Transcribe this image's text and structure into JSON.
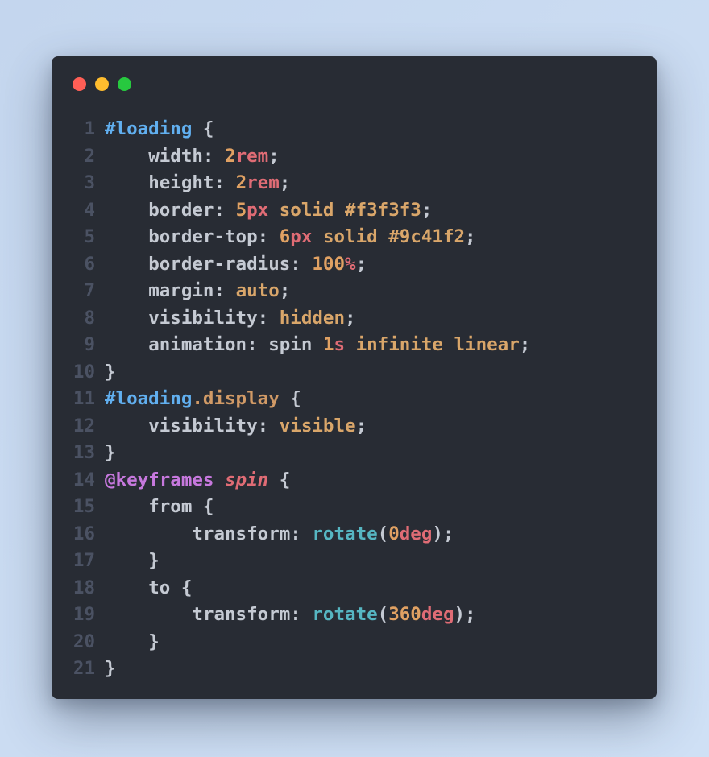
{
  "window": {
    "controls": [
      {
        "name": "close",
        "color": "#ff5f56"
      },
      {
        "name": "minimize",
        "color": "#ffbd2e"
      },
      {
        "name": "maximize",
        "color": "#27c93f"
      }
    ],
    "background_color": "#282c34"
  },
  "code": {
    "language": "css",
    "lines": [
      {
        "n": "1",
        "tokens": [
          [
            "selector",
            "#loading"
          ],
          [
            "punct",
            " {"
          ]
        ]
      },
      {
        "n": "2",
        "tokens": [
          [
            "plain",
            "    "
          ],
          [
            "prop",
            "width"
          ],
          [
            "punct",
            ": "
          ],
          [
            "num",
            "2"
          ],
          [
            "unit",
            "rem"
          ],
          [
            "punct",
            ";"
          ]
        ]
      },
      {
        "n": "3",
        "tokens": [
          [
            "plain",
            "    "
          ],
          [
            "prop",
            "height"
          ],
          [
            "punct",
            ": "
          ],
          [
            "num",
            "2"
          ],
          [
            "unit",
            "rem"
          ],
          [
            "punct",
            ";"
          ]
        ]
      },
      {
        "n": "4",
        "tokens": [
          [
            "plain",
            "    "
          ],
          [
            "prop",
            "border"
          ],
          [
            "punct",
            ": "
          ],
          [
            "num",
            "5"
          ],
          [
            "unit",
            "px"
          ],
          [
            "plain",
            " "
          ],
          [
            "value",
            "solid"
          ],
          [
            "plain",
            " "
          ],
          [
            "value",
            "#f3f3f3"
          ],
          [
            "punct",
            ";"
          ]
        ]
      },
      {
        "n": "5",
        "tokens": [
          [
            "plain",
            "    "
          ],
          [
            "prop",
            "border-top"
          ],
          [
            "punct",
            ": "
          ],
          [
            "num",
            "6"
          ],
          [
            "unit",
            "px"
          ],
          [
            "plain",
            " "
          ],
          [
            "value",
            "solid"
          ],
          [
            "plain",
            " "
          ],
          [
            "value",
            "#9c41f2"
          ],
          [
            "punct",
            ";"
          ]
        ]
      },
      {
        "n": "6",
        "tokens": [
          [
            "plain",
            "    "
          ],
          [
            "prop",
            "border-radius"
          ],
          [
            "punct",
            ": "
          ],
          [
            "num",
            "100"
          ],
          [
            "unit",
            "%"
          ],
          [
            "punct",
            ";"
          ]
        ]
      },
      {
        "n": "7",
        "tokens": [
          [
            "plain",
            "    "
          ],
          [
            "prop",
            "margin"
          ],
          [
            "punct",
            ": "
          ],
          [
            "value",
            "auto"
          ],
          [
            "punct",
            ";"
          ]
        ]
      },
      {
        "n": "8",
        "tokens": [
          [
            "plain",
            "    "
          ],
          [
            "prop",
            "visibility"
          ],
          [
            "punct",
            ": "
          ],
          [
            "value",
            "hidden"
          ],
          [
            "punct",
            ";"
          ]
        ]
      },
      {
        "n": "9",
        "tokens": [
          [
            "plain",
            "    "
          ],
          [
            "prop",
            "animation"
          ],
          [
            "punct",
            ": "
          ],
          [
            "plain",
            "spin "
          ],
          [
            "num",
            "1"
          ],
          [
            "unit",
            "s"
          ],
          [
            "plain",
            " "
          ],
          [
            "value",
            "infinite"
          ],
          [
            "plain",
            " "
          ],
          [
            "value",
            "linear"
          ],
          [
            "punct",
            ";"
          ]
        ]
      },
      {
        "n": "10",
        "tokens": [
          [
            "punct",
            "}"
          ]
        ]
      },
      {
        "n": "11",
        "tokens": [
          [
            "selector",
            "#loading"
          ],
          [
            "class",
            ".display"
          ],
          [
            "punct",
            " {"
          ]
        ]
      },
      {
        "n": "12",
        "tokens": [
          [
            "plain",
            "    "
          ],
          [
            "prop",
            "visibility"
          ],
          [
            "punct",
            ": "
          ],
          [
            "value",
            "visible"
          ],
          [
            "punct",
            ";"
          ]
        ]
      },
      {
        "n": "13",
        "tokens": [
          [
            "punct",
            "}"
          ]
        ]
      },
      {
        "n": "14",
        "tokens": [
          [
            "atrule",
            "@keyframes"
          ],
          [
            "plain",
            " "
          ],
          [
            "name",
            "spin"
          ],
          [
            "punct",
            " {"
          ]
        ]
      },
      {
        "n": "15",
        "tokens": [
          [
            "plain",
            "    "
          ],
          [
            "plain",
            "from"
          ],
          [
            "punct",
            " {"
          ]
        ]
      },
      {
        "n": "16",
        "tokens": [
          [
            "plain",
            "        "
          ],
          [
            "prop",
            "transform"
          ],
          [
            "punct",
            ": "
          ],
          [
            "func",
            "rotate"
          ],
          [
            "punct",
            "("
          ],
          [
            "num",
            "0"
          ],
          [
            "unit",
            "deg"
          ],
          [
            "punct",
            ");"
          ]
        ]
      },
      {
        "n": "17",
        "tokens": [
          [
            "plain",
            "    "
          ],
          [
            "punct",
            "}"
          ]
        ]
      },
      {
        "n": "18",
        "tokens": [
          [
            "plain",
            "    "
          ],
          [
            "plain",
            "to"
          ],
          [
            "punct",
            " {"
          ]
        ]
      },
      {
        "n": "19",
        "tokens": [
          [
            "plain",
            "        "
          ],
          [
            "prop",
            "transform"
          ],
          [
            "punct",
            ": "
          ],
          [
            "func",
            "rotate"
          ],
          [
            "punct",
            "("
          ],
          [
            "num",
            "360"
          ],
          [
            "unit",
            "deg"
          ],
          [
            "punct",
            ");"
          ]
        ]
      },
      {
        "n": "20",
        "tokens": [
          [
            "plain",
            "    "
          ],
          [
            "punct",
            "}"
          ]
        ]
      },
      {
        "n": "21",
        "tokens": [
          [
            "punct",
            "}"
          ]
        ]
      }
    ]
  }
}
